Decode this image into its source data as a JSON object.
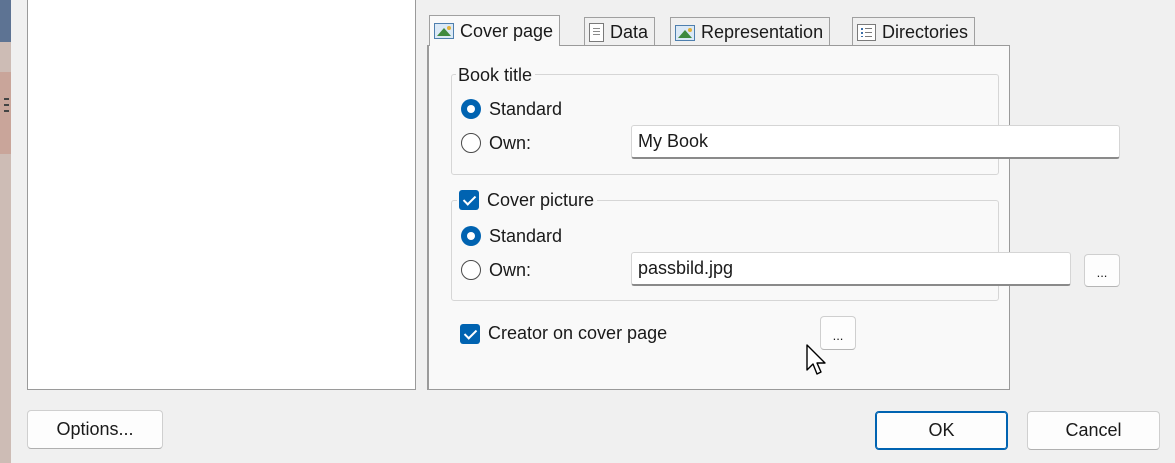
{
  "tabs": [
    {
      "label": "Cover page",
      "icon": "picture-icon"
    },
    {
      "label": "Data",
      "icon": "document-icon"
    },
    {
      "label": "Representation",
      "icon": "picture-icon"
    },
    {
      "label": "Directories",
      "icon": "list-icon"
    }
  ],
  "active_tab": "Cover page",
  "book_title": {
    "group_label": "Book title",
    "standard_label": "Standard",
    "own_label": "Own:",
    "own_value": "My Book",
    "selected": "Standard"
  },
  "cover_picture": {
    "checkbox_label": "Cover picture",
    "checked": true,
    "standard_label": "Standard",
    "own_label": "Own:",
    "own_value": "passbild.jpg",
    "browse_label": "...",
    "selected": "Standard"
  },
  "creator": {
    "checkbox_label": "Creator on cover page",
    "checked": true,
    "settings_label": "..."
  },
  "footer": {
    "options_label": "Options...",
    "ok_label": "OK",
    "cancel_label": "Cancel"
  },
  "colors": {
    "accent": "#0063b1",
    "panel_background": "#f9f9f9",
    "dialog_background": "#f0f0f0"
  }
}
